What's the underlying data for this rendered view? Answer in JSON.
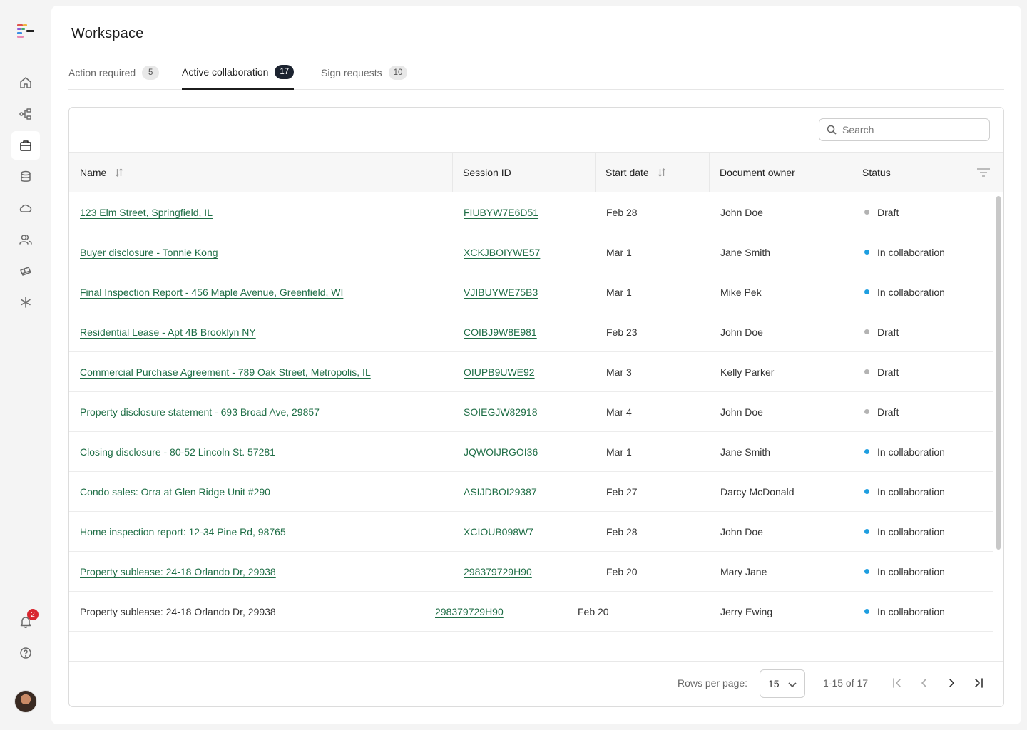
{
  "colors": {
    "link": "#1f6e46",
    "status_draft": "#b3b3b3",
    "status_collab": "#1e9ee0",
    "active_tab_count_bg": "#1c2330",
    "notification_badge": "#d8262f"
  },
  "sidebar": {
    "logo": "brand-logo",
    "items": [
      {
        "icon": "home-icon"
      },
      {
        "icon": "workflow-icon"
      },
      {
        "icon": "briefcase-icon",
        "active": true
      },
      {
        "icon": "database-icon"
      },
      {
        "icon": "cloud-icon"
      },
      {
        "icon": "users-icon"
      },
      {
        "icon": "tickets-icon"
      },
      {
        "icon": "asterisk-icon"
      }
    ],
    "notifications": {
      "icon": "bell-icon",
      "count": "2"
    },
    "help": {
      "icon": "help-icon"
    },
    "avatar": "user-avatar"
  },
  "page": {
    "title": "Workspace"
  },
  "tabs": [
    {
      "label": "Action required",
      "count": "5"
    },
    {
      "label": "Active collaboration",
      "count": "17",
      "active": true
    },
    {
      "label": "Sign requests",
      "count": "10"
    }
  ],
  "search": {
    "placeholder": "Search",
    "value": ""
  },
  "table": {
    "columns": [
      "Name",
      "Session ID",
      "Start date",
      "Document owner",
      "Status"
    ],
    "rows": [
      {
        "name": "123 Elm Street, Springfield, IL",
        "session": "FIUBYW7E6D51",
        "date": "Feb 28",
        "owner": "John Doe",
        "status": "Draft"
      },
      {
        "name": "Buyer disclosure - Tonnie Kong",
        "session": "XCKJBOIYWE57",
        "date": "Mar 1",
        "owner": "Jane Smith",
        "status": "In collaboration"
      },
      {
        "name": "Final Inspection Report - 456 Maple Avenue, Greenfield, WI",
        "session": "VJIBUYWE75B3",
        "date": "Mar 1",
        "owner": "Mike Pek",
        "status": "In collaboration"
      },
      {
        "name": "Residential Lease - Apt 4B Brooklyn NY",
        "session": "COIBJ9W8E981",
        "date": "Feb 23",
        "owner": "John Doe",
        "status": "Draft"
      },
      {
        "name": "Commercial Purchase Agreement - 789 Oak Street, Metropolis, IL",
        "session": "OIUPB9UWE92",
        "date": "Mar 3",
        "owner": "Kelly Parker",
        "status": "Draft"
      },
      {
        "name": "Property disclosure statement - 693 Broad Ave, 29857",
        "session": "SOIEGJW82918",
        "date": "Mar 4",
        "owner": "John Doe",
        "status": "Draft"
      },
      {
        "name": "Closing disclosure - 80-52 Lincoln St. 57281",
        "session": "JQWOIJRGOI36",
        "date": "Mar 1",
        "owner": "Jane Smith",
        "status": "In collaboration"
      },
      {
        "name": "Condo sales: Orra at Glen Ridge Unit #290",
        "session": "ASIJDBOI29387",
        "date": "Feb 27",
        "owner": "Darcy McDonald",
        "status": "In collaboration"
      },
      {
        "name": "Home inspection report: 12-34 Pine Rd, 98765",
        "session": "XCIOUB098W7",
        "date": "Feb 28",
        "owner": "John Doe",
        "status": "In collaboration"
      },
      {
        "name": "Property sublease: 24-18 Orlando Dr, 29938",
        "session": "298379729H90",
        "date": "Feb 20",
        "owner": "Mary Jane",
        "status": "In collaboration"
      },
      {
        "name": "Property sublease: 24-18 Orlando Dr, 29938",
        "session": "298379729H90",
        "date": "Feb 20",
        "owner": "Jerry Ewing",
        "status": "In collaboration",
        "plain": true
      }
    ]
  },
  "pagination": {
    "rows_per_page_label": "Rows per page:",
    "rows_per_page": "15",
    "range": "1-15 of 17"
  }
}
